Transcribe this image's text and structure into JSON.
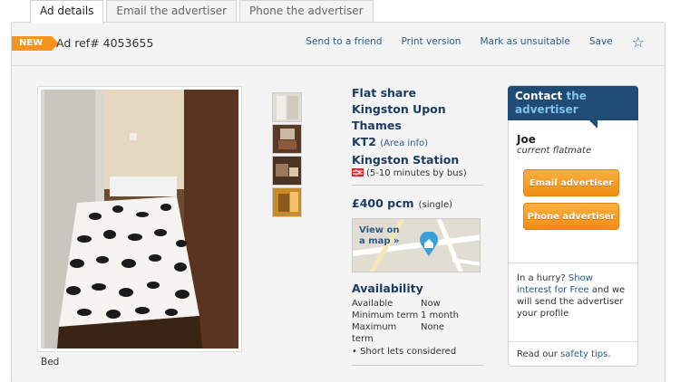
{
  "tabs": [
    {
      "label": "Ad details",
      "active": true
    },
    {
      "label": "Email the advertiser",
      "active": false
    },
    {
      "label": "Phone the advertiser",
      "active": false
    }
  ],
  "header": {
    "badge": "NEW",
    "ad_ref": "Ad ref# 4053655",
    "links": [
      "Send to a friend",
      "Print version",
      "Mark as unsuitable",
      "Save"
    ]
  },
  "photo": {
    "caption": "Bed"
  },
  "listing": {
    "type": "Flat share",
    "area_line1": "Kingston Upon",
    "area_line2": "Thames",
    "postcode": "KT2",
    "area_info": "(Area info)",
    "station": "Kingston Station",
    "station_time": "(5-10 minutes by bus)",
    "price": "£400 pcm",
    "price_note": "(single)",
    "map_label_1": "View on",
    "map_label_2": "a map »",
    "availability_title": "Availability",
    "availability": [
      {
        "k": "Available",
        "v": "Now"
      },
      {
        "k": "Minimum term",
        "v": "1 month"
      },
      {
        "k": "Maximum term",
        "v": "None"
      }
    ],
    "short_lets": "Short lets considered"
  },
  "contact": {
    "head_w": "Contact",
    "head_b1": "the",
    "head_b2": "advertiser",
    "name": "Joe",
    "role": "current flatmate",
    "email_btn": "Email advertiser",
    "phone_btn": "Phone advertiser",
    "hurry_1": "In a hurry?",
    "hurry_link": "Show interest for Free",
    "hurry_2": "and we will send the advertiser your profile",
    "safety_1": "Read our",
    "safety_link": "safety tips",
    "safety_2": "."
  },
  "colors": {
    "accent": "#f7941d",
    "brand": "#1f4b74",
    "link": "#2a5b8c"
  }
}
